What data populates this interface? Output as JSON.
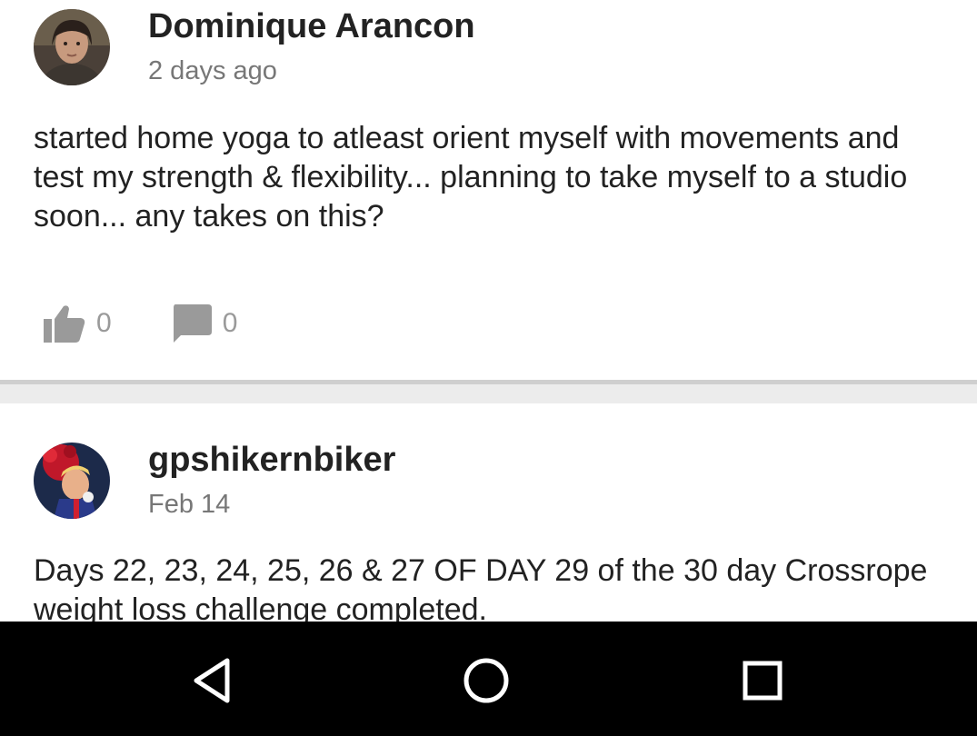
{
  "posts": [
    {
      "author": "Dominique Arancon",
      "timestamp": "2 days ago",
      "body": "started home yoga to atleast orient myself with movements and test my strength & flexibility... planning to take myself to a studio soon... any takes on this?",
      "likes": "0",
      "comments": "0"
    },
    {
      "author": "gpshikernbiker",
      "timestamp": "Feb 14",
      "body": "Days 22, 23, 24, 25, 26 & 27 OF DAY 29 of the 30 day Crossrope weight loss challenge completed."
    }
  ],
  "icons": {
    "like": "thumbs-up-icon",
    "comment": "comment-bubble-icon",
    "back": "back-triangle-icon",
    "home": "home-circle-icon",
    "recents": "recents-square-icon"
  },
  "colors": {
    "text": "#222222",
    "muted": "#777777",
    "icon": "#9a9a9a",
    "navbar": "#000000",
    "separator": "#cfcfcf"
  }
}
